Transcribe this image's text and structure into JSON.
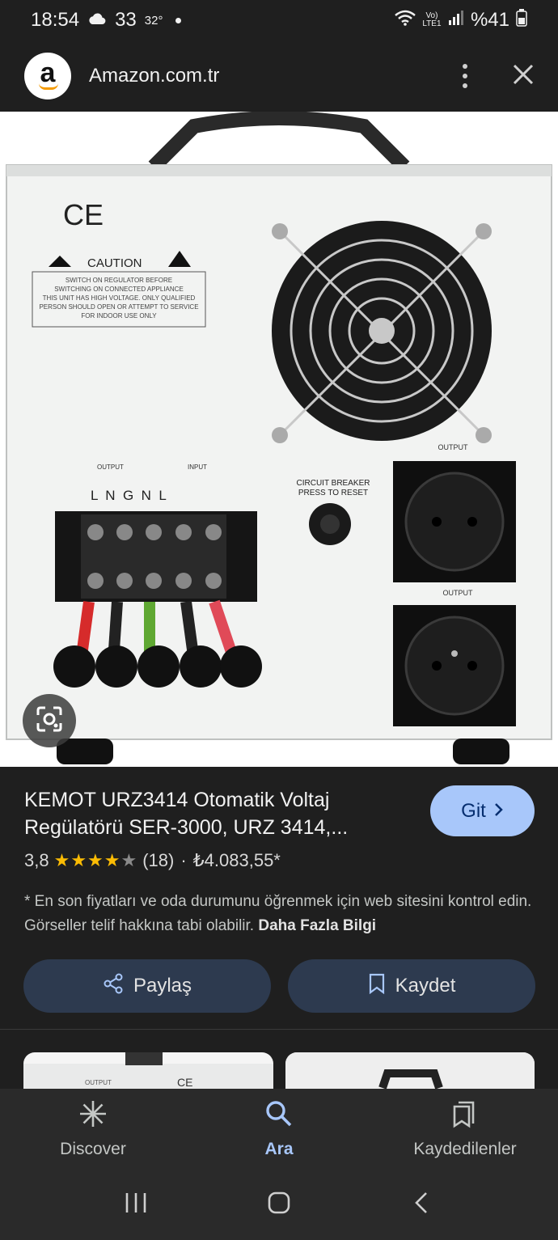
{
  "status_bar": {
    "time": "18:54",
    "weather": "33",
    "temperature": "32°",
    "network": "Vo) LTE1",
    "battery": "%41"
  },
  "header": {
    "logo_letter": "a",
    "site": "Amazon.com.tr"
  },
  "product": {
    "title": "KEMOT URZ3414 Otomatik Voltaj Regülatörü SER-3000, URZ 3414,...",
    "rating": "3,8",
    "star_count": 4,
    "review_count": "(18)",
    "separator": "·",
    "price": "₺4.083,55*",
    "go_label": "Git"
  },
  "disclaimer": {
    "text": "* En son fiyatları ve oda durumunu öğrenmek için web sitesini kontrol edin. Görseller telif hakkına tabi olabilir.",
    "link": "Daha Fazla Bilgi"
  },
  "actions": {
    "share_label": "Paylaş",
    "save_label": "Kaydet"
  },
  "image_labels": {
    "ce": "CE",
    "caution": "CAUTION",
    "caution_lines": [
      "SWITCH ON REGULATOR BEFORE",
      "SWITCHING ON CONNECTED APPLIANCE",
      "THIS UNIT HAS HIGH VOLTAGE. ONLY QUALIFIED",
      "PERSON SHOULD OPEN OR ATTEMPT TO SERVICE",
      "FOR INDOOR USE ONLY"
    ],
    "output_small": "OUTPUT",
    "input_small": "INPUT",
    "terminals": "L  N  G  N  L",
    "breaker_1": "CIRCUIT BREAKER",
    "breaker_2": "PRESS TO RESET",
    "output_1": "OUTPUT",
    "output_2": "OUTPUT"
  },
  "related": {
    "thumb1_output": "OUTPUT",
    "thumb1_ce": "CE"
  },
  "bottom_nav": {
    "items": [
      "Discover",
      "Ara",
      "Kaydedilenler"
    ],
    "active": "Ara"
  },
  "colors": {
    "accent": "#a8c7fa",
    "star": "#fbbc04",
    "background": "#1f1f1f"
  }
}
